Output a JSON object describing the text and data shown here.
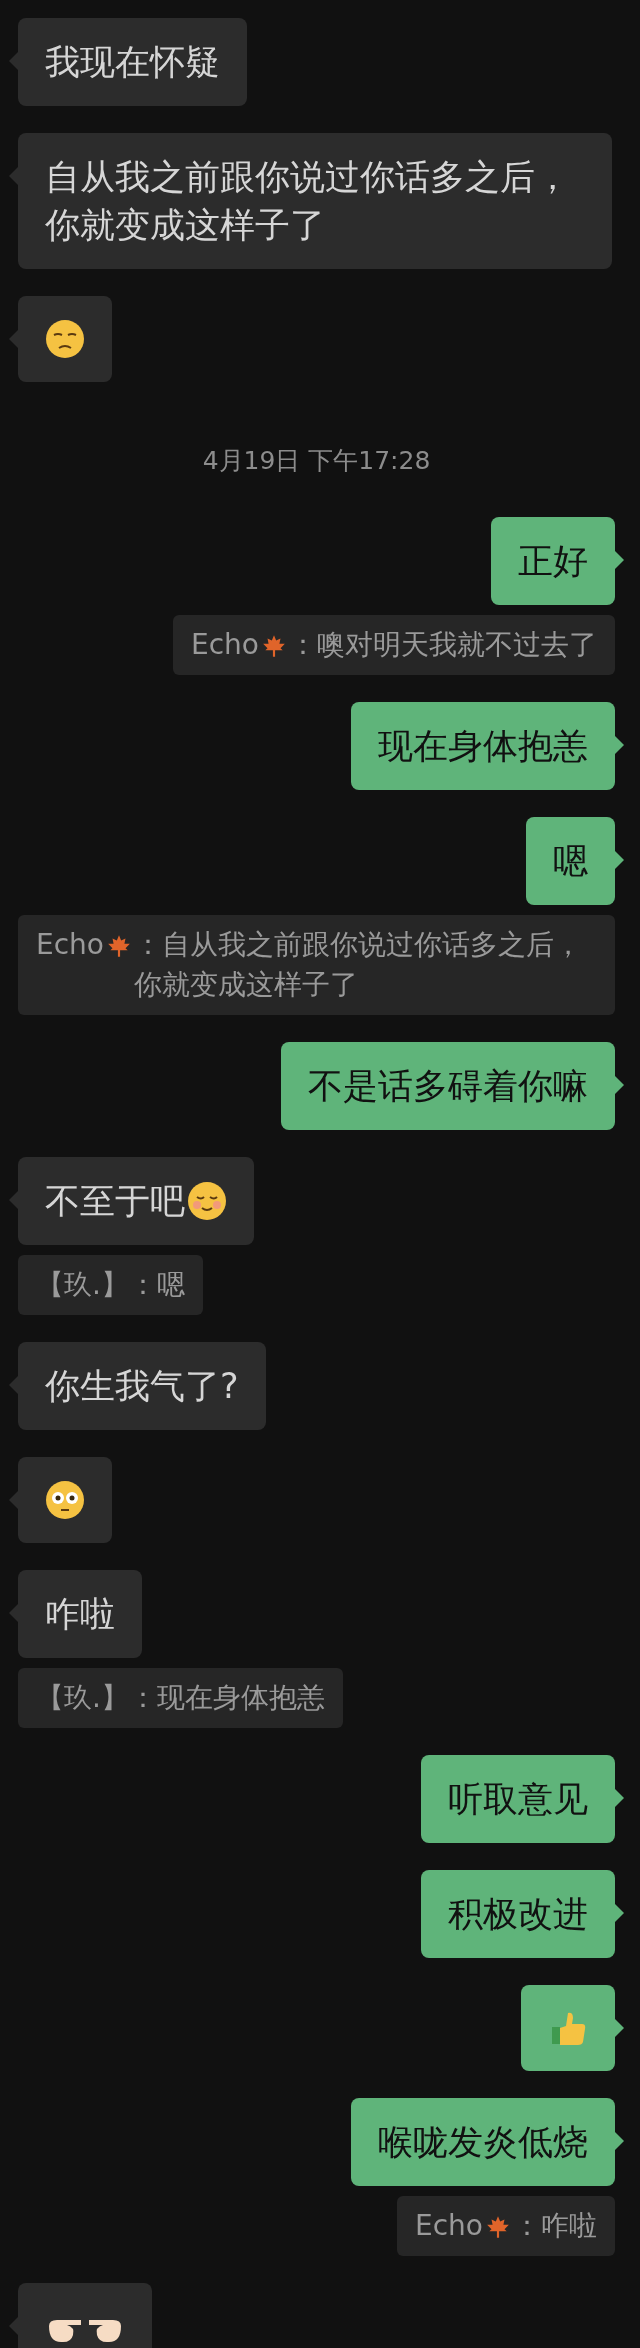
{
  "messages": [
    {
      "kind": "text",
      "outgoing": false,
      "text": "我现在怀疑"
    },
    {
      "kind": "text",
      "outgoing": false,
      "text": "自从我之前跟你说过你话多之后，你就变成这样子了"
    },
    {
      "kind": "emoji",
      "outgoing": false
    },
    {
      "kind": "time",
      "text": "4月19日 下午17:28"
    },
    {
      "kind": "text",
      "outgoing": true,
      "text": "正好"
    },
    {
      "kind": "quote",
      "outgoing": true,
      "sender": "Echo",
      "sender_icon": true,
      "text": "：噢对明天我就不过去了"
    },
    {
      "kind": "text",
      "outgoing": true,
      "text": "现在身体抱恙"
    },
    {
      "kind": "text",
      "outgoing": true,
      "text": "嗯"
    },
    {
      "kind": "quote",
      "outgoing": false,
      "sender": "Echo",
      "sender_icon": true,
      "text": "：自从我之前跟你说过你话多之后，你就变成这样子了"
    },
    {
      "kind": "text",
      "outgoing": true,
      "text": "不是话多碍着你嘛"
    },
    {
      "kind": "text",
      "outgoing": false,
      "text": "不至于吧",
      "trailing_emoji": true
    },
    {
      "kind": "quote",
      "outgoing": false,
      "sender": "【玖.】",
      "sender_icon": false,
      "text": "：嗯"
    },
    {
      "kind": "text",
      "outgoing": false,
      "text": "你生我气了?"
    },
    {
      "kind": "emoji",
      "outgoing": false
    },
    {
      "kind": "text",
      "outgoing": false,
      "text": "咋啦"
    },
    {
      "kind": "quote",
      "outgoing": false,
      "sender": "【玖.】",
      "sender_icon": false,
      "text": "：现在身体抱恙"
    },
    {
      "kind": "text",
      "outgoing": true,
      "text": "听取意见"
    },
    {
      "kind": "text",
      "outgoing": true,
      "text": "积极改进"
    },
    {
      "kind": "emoji",
      "outgoing": true
    },
    {
      "kind": "text",
      "outgoing": true,
      "text": "喉咙发炎低烧"
    },
    {
      "kind": "quote",
      "outgoing": true,
      "sender": "Echo",
      "sender_icon": true,
      "text": "：咋啦"
    },
    {
      "kind": "emoji",
      "outgoing": false
    }
  ]
}
